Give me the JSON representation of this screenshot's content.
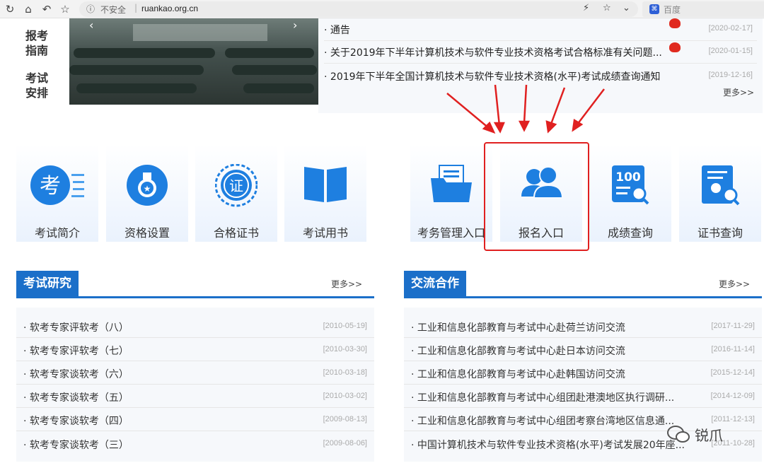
{
  "browser": {
    "nav_icons": [
      "reload-icon",
      "home-icon",
      "back-icon",
      "bookmark-star-icon"
    ],
    "security_label": "不安全",
    "separator": "|",
    "url": "ruankao.org.cn",
    "search_engine": "百度"
  },
  "side_nav": {
    "items": [
      {
        "label": "报考指南"
      },
      {
        "label": "考试安排"
      }
    ]
  },
  "notices": {
    "items": [
      {
        "title": "通告",
        "date": "[2020-02-17]",
        "new": true
      },
      {
        "title": "关于2019年下半年计算机技术与软件专业技术资格考试合格标准有关问题...",
        "date": "[2020-01-15]",
        "new": true
      },
      {
        "title": "2019年下半年全国计算机技术与软件专业技术资格(水平)考试成绩查询通知",
        "date": "[2019-12-16]",
        "new": false
      }
    ],
    "more": "更多>>"
  },
  "tiles": [
    {
      "label": "考试简介",
      "icon": "exam-intro-icon"
    },
    {
      "label": "资格设置",
      "icon": "qualification-medal-icon"
    },
    {
      "label": "合格证书",
      "icon": "certificate-seal-icon"
    },
    {
      "label": "考试用书",
      "icon": "book-icon"
    },
    {
      "label": "考务管理入口",
      "icon": "folder-document-icon"
    },
    {
      "label": "报名入口",
      "icon": "users-icon"
    },
    {
      "label": "成绩查询",
      "icon": "score-search-icon"
    },
    {
      "label": "证书查询",
      "icon": "certificate-search-icon"
    }
  ],
  "research": {
    "title": "考试研究",
    "more": "更多>>",
    "items": [
      {
        "title": "软考专家评软考（八）",
        "date": "[2010-05-19]"
      },
      {
        "title": "软考专家评软考（七）",
        "date": "[2010-03-30]"
      },
      {
        "title": "软考专家谈软考（六）",
        "date": "[2010-03-18]"
      },
      {
        "title": "软考专家谈软考（五）",
        "date": "[2010-03-02]"
      },
      {
        "title": "软考专家谈软考（四）",
        "date": "[2009-08-13]"
      },
      {
        "title": "软考专家谈软考（三）",
        "date": "[2009-08-06]"
      }
    ]
  },
  "cooperation": {
    "title": "交流合作",
    "more": "更多>>",
    "items": [
      {
        "title": "工业和信息化部教育与考试中心赴荷兰访问交流",
        "date": "[2017-11-29]"
      },
      {
        "title": "工业和信息化部教育与考试中心赴日本访问交流",
        "date": "[2016-11-14]"
      },
      {
        "title": "工业和信息化部教育与考试中心赴韩国访问交流",
        "date": "[2015-12-14]"
      },
      {
        "title": "工业和信息化部教育与考试中心组团赴港澳地区执行调研...",
        "date": "[2014-12-09]"
      },
      {
        "title": "工业和信息化部教育与考试中心组团考察台湾地区信息通...",
        "date": "[2011-12-13]"
      },
      {
        "title": "中国计算机技术与软件专业技术资格(水平)考试发展20年座...",
        "date": "[2011-10-28]"
      }
    ]
  },
  "watermark": {
    "text": "锐爪"
  },
  "colors": {
    "accent": "#1b6fc9",
    "highlight": "#e02020",
    "tile_icon": "#1e7fe0"
  }
}
